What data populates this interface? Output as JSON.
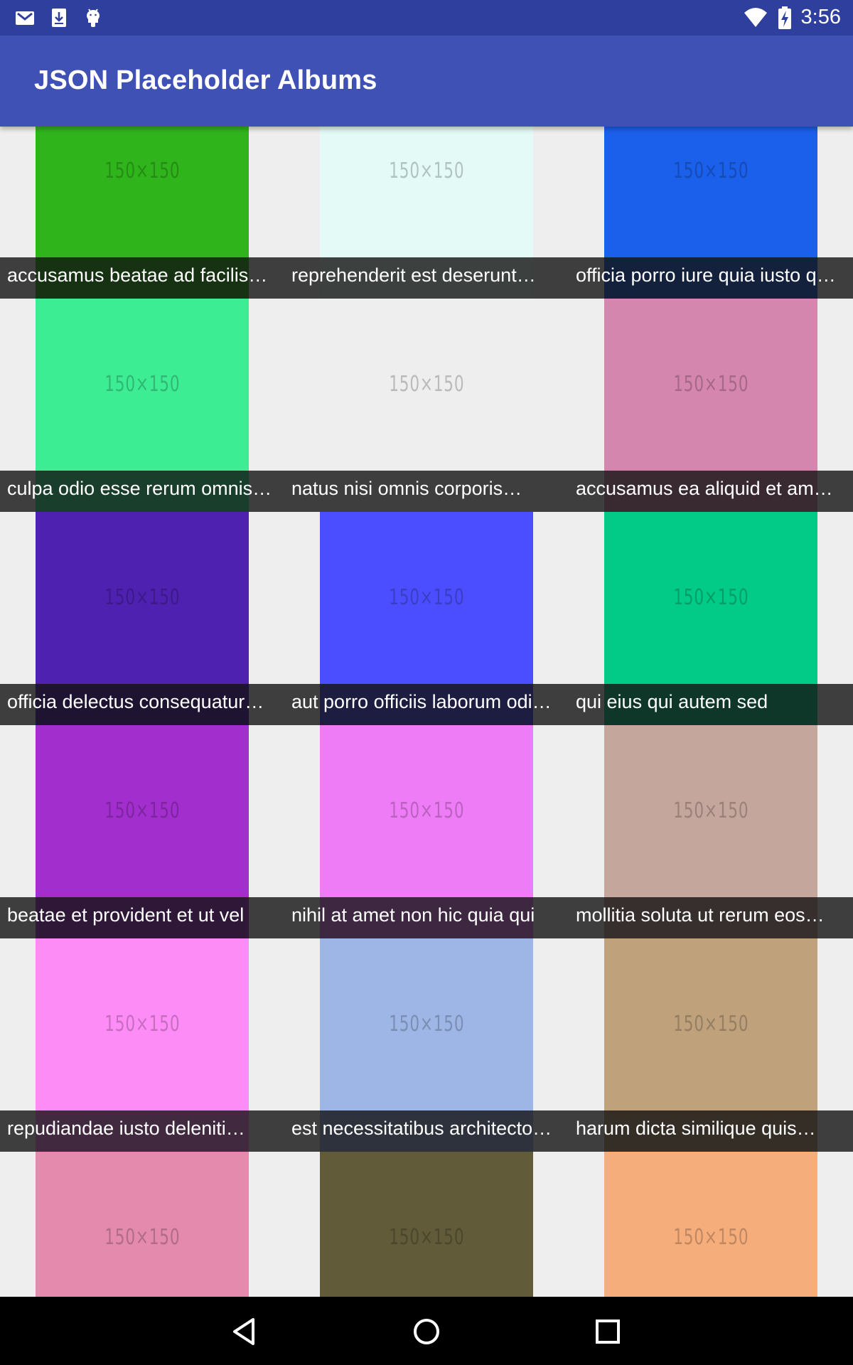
{
  "status_bar": {
    "time": "3:56",
    "left_icons": [
      "gmail-icon",
      "download-icon",
      "android-icon"
    ],
    "right_icons": [
      "wifi-icon",
      "battery-charging-icon"
    ]
  },
  "app_bar": {
    "title": "JSON Placeholder Albums"
  },
  "albums": [
    {
      "title": "accusamus beatae ad facilis…",
      "thumb_text": "150×150",
      "color": "#30b41c"
    },
    {
      "title": "reprehenderit est deserunt…",
      "thumb_text": "150×150",
      "color": "#e3faf6"
    },
    {
      "title": "officia porro iure quia iusto q…",
      "thumb_text": "150×150",
      "color": "#1b60eb"
    },
    {
      "title": "culpa odio esse rerum omnis…",
      "thumb_text": "150×150",
      "color": "#3ded94"
    },
    {
      "title": "natus nisi omnis corporis…",
      "thumb_text": "150×150",
      "color": "#eeeeee"
    },
    {
      "title": "accusamus ea aliquid et am…",
      "thumb_text": "150×150",
      "color": "#d486ae"
    },
    {
      "title": "officia delectus consequatur…",
      "thumb_text": "150×150",
      "color": "#4f21b1"
    },
    {
      "title": "aut porro officiis laborum odi…",
      "thumb_text": "150×150",
      "color": "#4b4efe"
    },
    {
      "title": "qui eius qui autem sed",
      "thumb_text": "150×150",
      "color": "#01cb87"
    },
    {
      "title": "beatae et provident et ut vel",
      "thumb_text": "150×150",
      "color": "#a22fcd"
    },
    {
      "title": "nihil at amet non hic quia qui",
      "thumb_text": "150×150",
      "color": "#ef7cf7"
    },
    {
      "title": "mollitia soluta ut rerum eos…",
      "thumb_text": "150×150",
      "color": "#c5a69c"
    },
    {
      "title": "repudiandae iusto deleniti…",
      "thumb_text": "150×150",
      "color": "#fe8cf6"
    },
    {
      "title": "est necessitatibus architecto…",
      "thumb_text": "150×150",
      "color": "#9db6e6"
    },
    {
      "title": "harum dicta similique quis…",
      "thumb_text": "150×150",
      "color": "#bfa27c"
    },
    {
      "title": "",
      "thumb_text": "150×150",
      "color": "#e48aac"
    },
    {
      "title": "",
      "thumb_text": "150×150",
      "color": "#615b39"
    },
    {
      "title": "",
      "thumb_text": "150×150",
      "color": "#f5ad7c"
    }
  ],
  "nav_bar": {
    "buttons": [
      "back-icon",
      "home-icon",
      "recents-icon"
    ]
  }
}
